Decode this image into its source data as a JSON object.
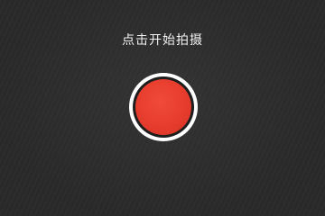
{
  "prompt": {
    "text": "点击开始拍摄"
  },
  "record_button": {
    "icon": "record-icon",
    "color": "#e53b2c",
    "ring_color": "#ffffff"
  }
}
